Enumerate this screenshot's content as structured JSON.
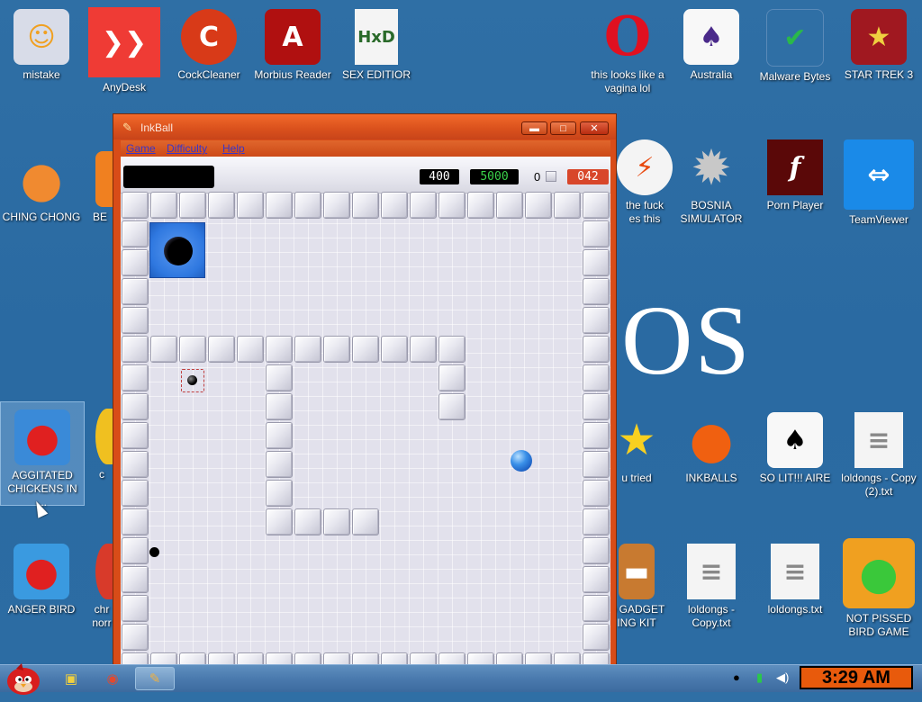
{
  "desktop": {
    "bg_text": "OS",
    "icons": {
      "mistake": {
        "label": "mistake",
        "glyph": "☺"
      },
      "anydesk": {
        "label": "AnyDesk",
        "glyph": "❯❯"
      },
      "cockcleaner": {
        "label": "CockCleaner",
        "glyph": "C"
      },
      "morbius": {
        "label": "Morbius Reader",
        "glyph": "A"
      },
      "sex_editior": {
        "label": "SEX EDITIOR",
        "glyph": "HxD"
      },
      "opera": {
        "label": "this looks like a vagina lol",
        "glyph": "O"
      },
      "australia": {
        "label": "Australia",
        "glyph": "♠"
      },
      "malwarebytes": {
        "label": "Malware Bytes",
        "glyph": "✔"
      },
      "startrek": {
        "label": "STAR TREK 3",
        "glyph": "★"
      },
      "chingchong": {
        "label": "CHING CHONG",
        "glyph": "●"
      },
      "be": {
        "label": "BE",
        "glyph": ""
      },
      "thefuck": {
        "label": "the fuck\nes this",
        "glyph": "⚡"
      },
      "bosnia": {
        "label": "BOSNIA SIMULATOR",
        "glyph": "✹"
      },
      "pornplayer": {
        "label": "Porn Player",
        "glyph": "f"
      },
      "teamviewer": {
        "label": "TeamViewer",
        "glyph": "⇔"
      },
      "aggitated": {
        "label": "AGGITATED CHICKENS IN ...",
        "glyph": "●"
      },
      "c_partial": {
        "label": "c",
        "glyph": ""
      },
      "utried": {
        "label": "u tried",
        "glyph": "★"
      },
      "inkballs": {
        "label": "INKBALLS",
        "glyph": "●"
      },
      "solit": {
        "label": "SO LIT!!! AIRE",
        "glyph": "♠"
      },
      "loldongs_copy2": {
        "label": "loldongs - Copy (2).txt",
        "glyph": "≡"
      },
      "angerbird": {
        "label": "ANGER BIRD",
        "glyph": "●"
      },
      "chr_partial": {
        "label": "chr\nnorr",
        "glyph": ""
      },
      "gadget": {
        "label": "D GADGET\nING KIT",
        "glyph": "▬"
      },
      "loldongs_copy": {
        "label": "loldongs - Copy.txt",
        "glyph": "≡"
      },
      "loldongs": {
        "label": "loldongs.txt",
        "glyph": "≡"
      },
      "notpissed": {
        "label": "NOT PISSED BIRD GAME",
        "glyph": "●"
      }
    }
  },
  "window": {
    "title": "InkBall",
    "controls": {
      "minimize": "▬",
      "maximize": "□",
      "close": "✕"
    },
    "menu": [
      "Game",
      "Difficulty",
      "Help"
    ],
    "scores": {
      "score": "400",
      "bonus": "5000",
      "count": "0",
      "timer": "042"
    }
  },
  "taskbar": {
    "clock": "3:29 AM",
    "tray": {
      "dot": "●",
      "battery": "▮",
      "volume": "◀)"
    }
  },
  "colors": {
    "window_frame": "#d84c18",
    "score_green": "#3ad24a",
    "timer_red": "#d8462a",
    "clock_bg": "#e85a0c"
  }
}
